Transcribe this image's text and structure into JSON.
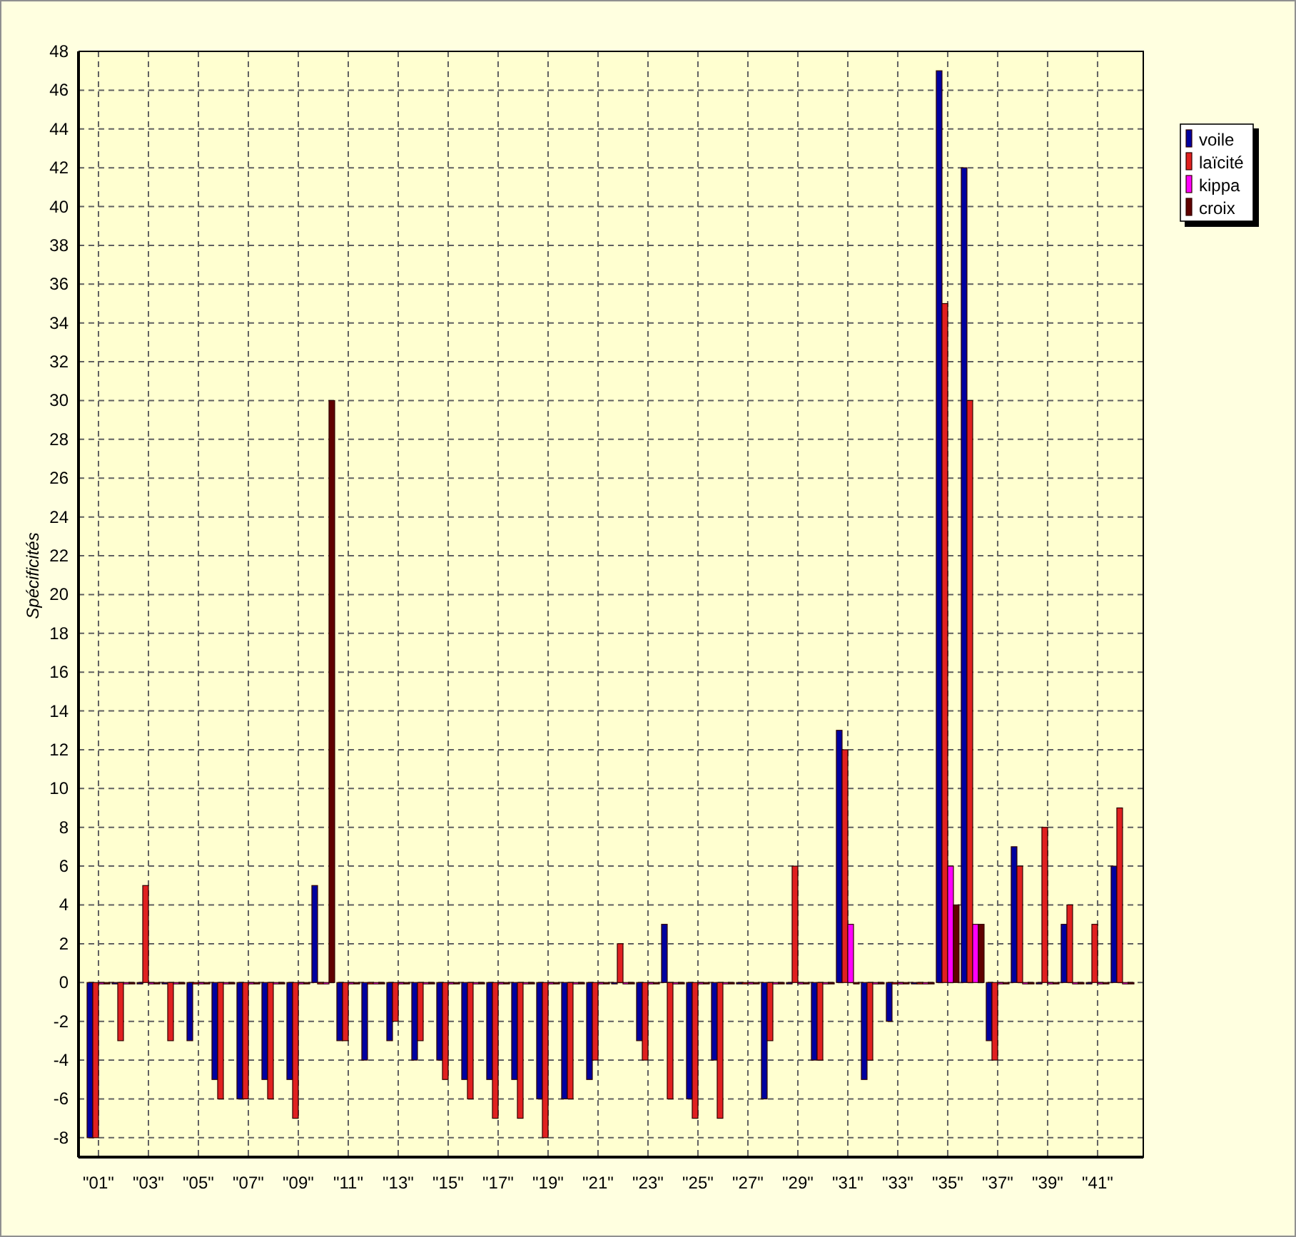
{
  "chart": {
    "chart_data": {
      "type": "bar",
      "ylabel": "Spécificités",
      "grid": true,
      "legend": true,
      "xlim": [
        0.2,
        42.83
      ],
      "x": [
        1,
        2,
        3,
        4,
        5,
        6,
        7,
        8,
        9,
        10,
        11,
        12,
        13,
        14,
        15,
        16,
        17,
        18,
        19,
        20,
        21,
        22,
        23,
        24,
        25,
        26,
        27,
        28,
        29,
        30,
        31,
        32,
        33,
        34,
        35,
        36,
        37,
        38,
        39,
        40,
        41,
        42
      ],
      "xticks": [
        {
          "value": 1,
          "label": "\"01\""
        },
        {
          "value": 3,
          "label": "\"03\""
        },
        {
          "value": 5,
          "label": "\"05\""
        },
        {
          "value": 7,
          "label": "\"07\""
        },
        {
          "value": 9,
          "label": "\"09\""
        },
        {
          "value": 11,
          "label": "\"11\""
        },
        {
          "value": 13,
          "label": "\"13\""
        },
        {
          "value": 15,
          "label": "\"15\""
        },
        {
          "value": 17,
          "label": "\"17\""
        },
        {
          "value": 19,
          "label": "\"19\""
        },
        {
          "value": 21,
          "label": "\"21\""
        },
        {
          "value": 23,
          "label": "\"23\""
        },
        {
          "value": 25,
          "label": "\"25\""
        },
        {
          "value": 27,
          "label": "\"27\""
        },
        {
          "value": 29,
          "label": "\"29\""
        },
        {
          "value": 31,
          "label": "\"31\""
        },
        {
          "value": 33,
          "label": "\"33\""
        },
        {
          "value": 35,
          "label": "\"35\""
        },
        {
          "value": 37,
          "label": "\"37\""
        },
        {
          "value": 39,
          "label": "\"39\""
        },
        {
          "value": 41,
          "label": "\"41\""
        }
      ],
      "ylim": [
        -9,
        48
      ],
      "yticks": [
        -8,
        -6,
        -4,
        -2,
        0,
        2,
        4,
        6,
        8,
        10,
        12,
        14,
        16,
        18,
        20,
        22,
        24,
        26,
        28,
        30,
        32,
        34,
        36,
        38,
        40,
        42,
        44,
        46,
        48
      ],
      "series": [
        {
          "name": "voile",
          "color": "#0000a0",
          "values": [
            -8,
            0,
            0,
            0,
            -3,
            -5,
            -6,
            -5,
            -5,
            5,
            -3,
            -4,
            -3,
            -4,
            -4,
            -5,
            -5,
            -5,
            -6,
            -6,
            -5,
            0,
            -3,
            3,
            -6,
            -4,
            0,
            -6,
            0,
            -4,
            13,
            -5,
            -2,
            0,
            47,
            42,
            -3,
            7,
            0,
            3,
            0,
            6
          ]
        },
        {
          "name": "laïcité",
          "color": "#e02020",
          "values": [
            -8,
            -3,
            5,
            -3,
            0,
            -6,
            -6,
            -6,
            -7,
            0,
            -3,
            0,
            -2,
            -3,
            -5,
            -6,
            -7,
            -7,
            -8,
            -6,
            -4,
            2,
            -4,
            -6,
            -7,
            -7,
            0,
            -3,
            6,
            -4,
            12,
            -4,
            0,
            0,
            35,
            30,
            -4,
            6,
            8,
            4,
            3,
            9
          ]
        },
        {
          "name": "kippa",
          "color": "#ff00ff",
          "values": [
            0,
            0,
            0,
            0,
            0,
            0,
            0,
            0,
            0,
            0,
            0,
            0,
            0,
            0,
            0,
            0,
            0,
            0,
            0,
            0,
            0,
            0,
            0,
            0,
            0,
            0,
            0,
            0,
            0,
            0,
            3,
            0,
            0,
            0,
            6,
            3,
            0,
            0,
            0,
            0,
            0,
            0
          ]
        },
        {
          "name": "croix",
          "color": "#600000",
          "values": [
            0,
            0,
            0,
            0,
            0,
            0,
            0,
            0,
            0,
            30,
            0,
            0,
            0,
            0,
            0,
            0,
            0,
            0,
            0,
            0,
            0,
            0,
            0,
            0,
            0,
            0,
            0,
            0,
            0,
            0,
            0,
            0,
            0,
            0,
            4,
            3,
            0,
            0,
            0,
            0,
            0,
            0
          ]
        }
      ]
    }
  }
}
